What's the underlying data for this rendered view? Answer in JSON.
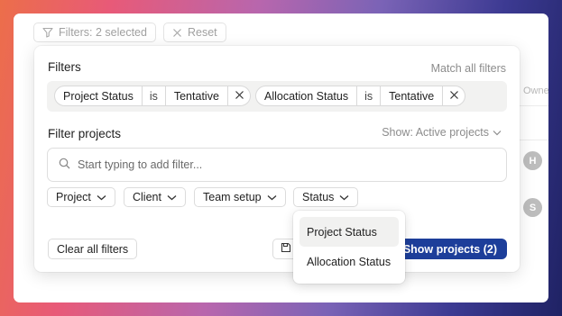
{
  "topbar": {
    "filters_chip_label": "Filters: 2 selected",
    "reset_label": "Reset"
  },
  "background": {
    "owner_column_header": "Owne",
    "avatars": [
      "H",
      "S"
    ]
  },
  "panel": {
    "title": "Filters",
    "match_all_label": "Match all filters",
    "active_filters": [
      {
        "field": "Project Status",
        "operator": "is",
        "value": "Tentative"
      },
      {
        "field": "Allocation Status",
        "operator": "is",
        "value": "Tentative"
      }
    ],
    "section_title": "Filter projects",
    "show_label": "Show: Active projects",
    "search": {
      "placeholder": "Start typing to add filter...",
      "value": ""
    },
    "dropdowns": [
      {
        "label": "Project"
      },
      {
        "label": "Client"
      },
      {
        "label": "Team setup"
      },
      {
        "label": "Status"
      }
    ],
    "clear_label": "Clear all filters",
    "show_button_label": "Show projects (2)"
  },
  "status_menu": {
    "items": [
      {
        "label": "Project Status",
        "highlighted": true
      },
      {
        "label": "Allocation Status",
        "highlighted": false
      }
    ]
  },
  "colors": {
    "primary_button": "#1d3e9a",
    "avatar": "#bdbdbd"
  }
}
